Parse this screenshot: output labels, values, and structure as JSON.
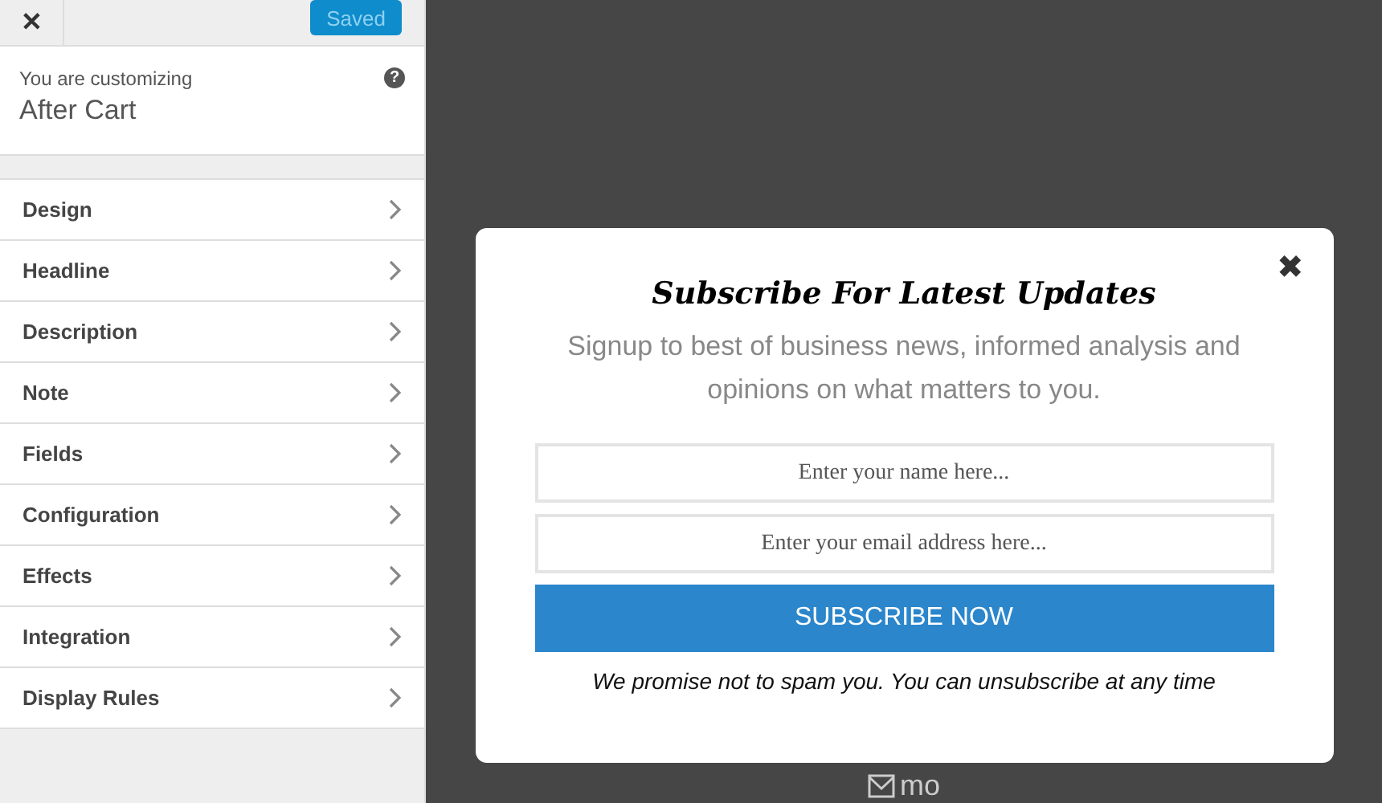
{
  "topbar": {
    "close": "✕",
    "save_button": "Saved"
  },
  "customizing": {
    "label": "You are customizing",
    "title": "After Cart",
    "help": "?"
  },
  "sections": [
    {
      "label": "Design"
    },
    {
      "label": "Headline"
    },
    {
      "label": "Description"
    },
    {
      "label": "Note"
    },
    {
      "label": "Fields"
    },
    {
      "label": "Configuration"
    },
    {
      "label": "Effects"
    },
    {
      "label": "Integration"
    },
    {
      "label": "Display Rules"
    }
  ],
  "popup": {
    "close": "✖",
    "headline": "Subscribe For Latest Updates",
    "description": "Signup to best of business news, informed analysis and opinions on what matters to you.",
    "fields": [
      {
        "placeholder": "Enter your name here..."
      },
      {
        "placeholder": "Enter your email address here..."
      }
    ],
    "button": "SUBSCRIBE NOW",
    "note": "We promise not to spam you. You can unsubscribe at any time"
  },
  "brand": {
    "text": "mo"
  }
}
